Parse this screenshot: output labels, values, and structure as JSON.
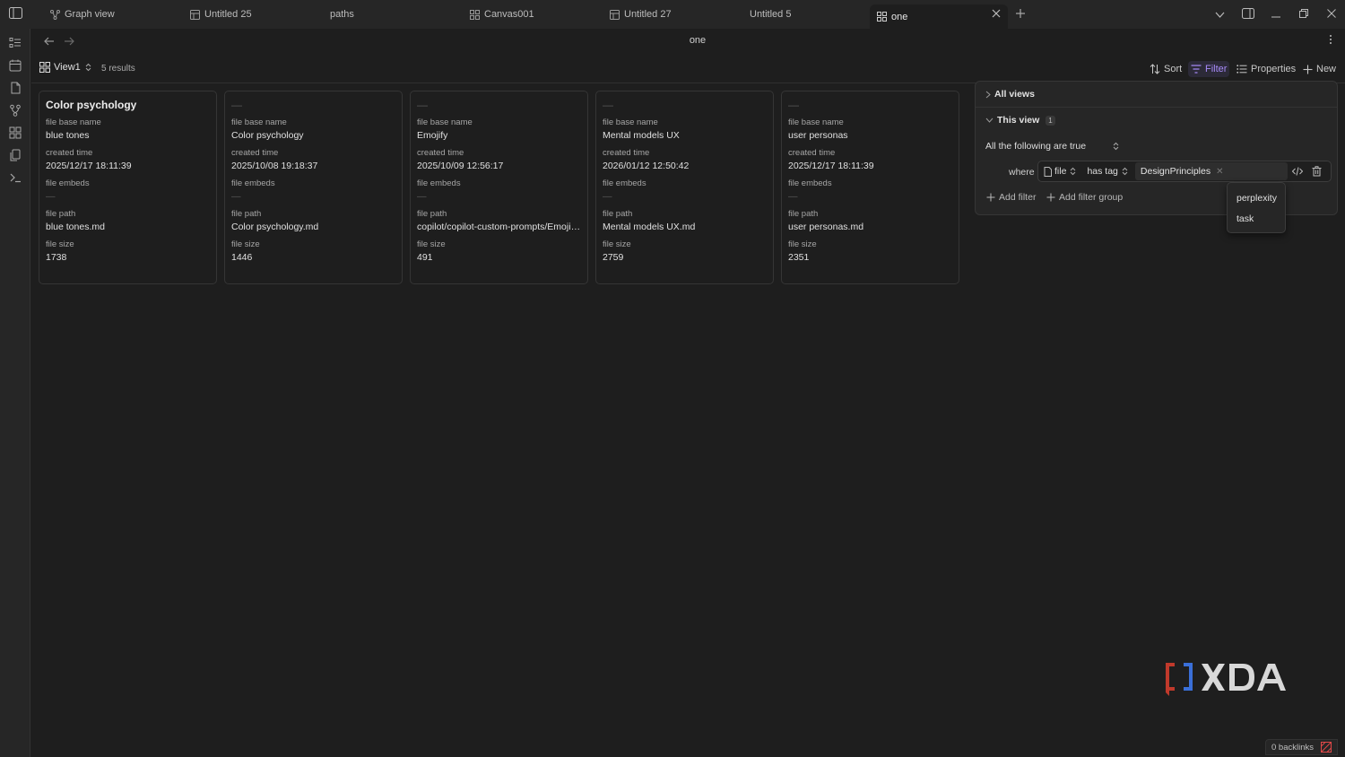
{
  "tabs": [
    {
      "label": "Graph view",
      "icon": "graph-icon"
    },
    {
      "label": "Untitled 25",
      "icon": "table-icon"
    },
    {
      "label": "paths",
      "icon": ""
    },
    {
      "label": "Canvas001",
      "icon": "canvas-icon"
    },
    {
      "label": "Untitled 27",
      "icon": "table-icon"
    },
    {
      "label": "Untitled 5",
      "icon": ""
    },
    {
      "label": "one",
      "icon": "grid-icon",
      "active": true
    }
  ],
  "page": {
    "title": "one"
  },
  "toolbar": {
    "view_label": "View1",
    "results": "5 results",
    "sort": "Sort",
    "filter": "Filter",
    "properties": "Properties",
    "new": "New"
  },
  "fields": {
    "base_name": "file base name",
    "created": "created time",
    "embeds": "file embeds",
    "path": "file path",
    "size": "file size",
    "empty": "—"
  },
  "cards": [
    {
      "title": "Color psychology",
      "base_name": "blue tones",
      "created": "2025/12/17 18:11:39",
      "embeds": "—",
      "path": "blue tones.md",
      "size": "1738"
    },
    {
      "title": "—",
      "base_name": "Color psychology",
      "created": "2025/10/08 19:18:37",
      "embeds": "—",
      "path": "Color psychology.md",
      "size": "1446"
    },
    {
      "title": "—",
      "base_name": "Emojify",
      "created": "2025/10/09 12:56:17",
      "embeds": "—",
      "path": "copilot/copilot-custom-prompts/Emojify.md",
      "size": "491"
    },
    {
      "title": "—",
      "base_name": "Mental models UX",
      "created": "2026/01/12 12:50:42",
      "embeds": "—",
      "path": "Mental models UX.md",
      "size": "2759"
    },
    {
      "title": "—",
      "base_name": "user personas",
      "created": "2025/12/17 18:11:39",
      "embeds": "—",
      "path": "user personas.md",
      "size": "2351"
    }
  ],
  "filter_panel": {
    "all_views": "All views",
    "this_view": "This view",
    "this_view_count": "1",
    "conjunction": "All the following are true",
    "where": "where",
    "property": "file",
    "operator": "has tag",
    "value": "DesignPrinciples",
    "add_filter": "Add filter",
    "add_filter_group": "Add filter group"
  },
  "dropdown": {
    "options": [
      "perplexity",
      "task"
    ]
  },
  "status": {
    "backlinks": "0 backlinks"
  },
  "colors": {
    "accent": "#a88bfa",
    "background": "#1e1e1e",
    "panel": "#262626",
    "error": "#e04848"
  }
}
